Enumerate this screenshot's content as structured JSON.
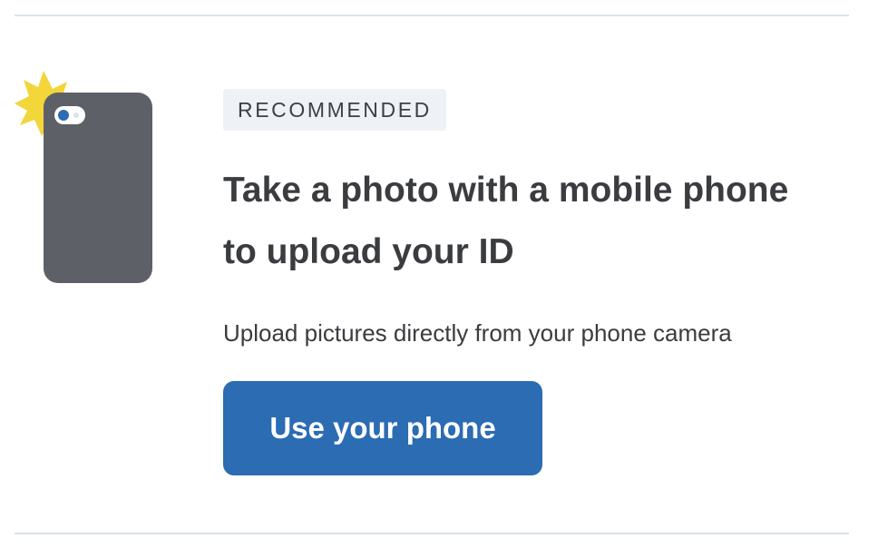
{
  "upload_option": {
    "badge": "RECOMMENDED",
    "title_line1": "Take a photo with a mobile phone",
    "title_line2": "to upload your ID",
    "description": "Upload pictures directly from your phone camera",
    "button_label": "Use your phone",
    "icon": "phone-camera-icon"
  },
  "colors": {
    "button": "#2b6cb3",
    "badge_background": "#eef2f6",
    "phone_body": "#5d6067",
    "flash": "#f2d63a",
    "divider": "#dbe3ea"
  }
}
